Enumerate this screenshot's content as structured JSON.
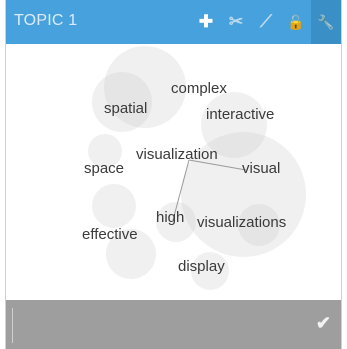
{
  "title": "TOPIC 1",
  "toolbar": {
    "tools": [
      {
        "name": "add",
        "glyph": "✚"
      },
      {
        "name": "cut",
        "glyph": "✂"
      },
      {
        "name": "link",
        "glyph": "⟋"
      },
      {
        "name": "lock",
        "glyph": "🔓"
      },
      {
        "name": "settings",
        "glyph": "🔧"
      }
    ]
  },
  "words": [
    "complex",
    "spatial",
    "interactive",
    "space",
    "visualization",
    "visual",
    "effective",
    "high",
    "visualizations",
    "display"
  ],
  "footer": {
    "value": "",
    "confirm_icon": "check-icon"
  },
  "colors": {
    "header": "#46a1dc",
    "footer": "#9e9e9e"
  }
}
